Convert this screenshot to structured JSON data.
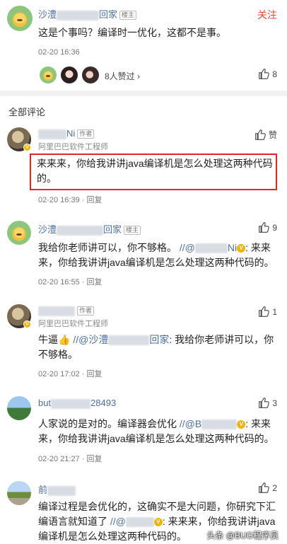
{
  "post": {
    "author_prefix": "沙澧",
    "author_suffix": "回家",
    "author_tag": "楼主",
    "follow_label": "关注",
    "content": "这是个事吗？编译时一优化，这都不是事。",
    "time": "02-20 16:36",
    "liked_by": "8人赞过",
    "like_count": "8"
  },
  "section_title": "全部评论",
  "comments": [
    {
      "name_suffix": "Ni",
      "tag": "作者",
      "title": "阿里巴巴软件工程师",
      "text": "来来来，你给我讲讲java编译机是怎么处理这两种代码的。",
      "time": "02-20 16:39",
      "reply": "回复",
      "like": "赞"
    },
    {
      "name_prefix": "沙澧",
      "name_suffix": "回家",
      "tag": "楼主",
      "text_main": "我给你老师讲可以，你不够格。",
      "mention": "//@",
      "mention_name_suffix": "Ni",
      "quote": ": 来来来，你给我讲讲java编译机是怎么处理这两种代码的。",
      "time": "02-20 16:55",
      "reply": "回复",
      "like": "9"
    },
    {
      "tag": "作者",
      "title": "阿里巴巴软件工程师",
      "text_main": "牛逼👍",
      "mention": "//@沙澧",
      "mention_suffix": "回家",
      "quote": ": 我给你老师讲可以，你不够格。",
      "time": "02-20 17:02",
      "reply": "回复",
      "like": "1"
    },
    {
      "name_prefix": "but",
      "name_suffix": "28493",
      "text_main": "人家说的是对的。编译器会优化",
      "mention": "//@B",
      "quote": ": 来来来，你给我讲讲java编译机是怎么处理这两种代码的。",
      "time": "02-20 21:27",
      "reply": "回复",
      "like": "3"
    },
    {
      "name_prefix": "前",
      "text_main": "编译过程是会优化的，这确实不是大问题，你研究下汇编语言就知道了",
      "mention": "//@",
      "quote": ": 来来来，你给我讲讲java编译机是怎么处理这两种代码的。",
      "like": "2"
    }
  ],
  "watermark": "头条 @BUG程序员"
}
